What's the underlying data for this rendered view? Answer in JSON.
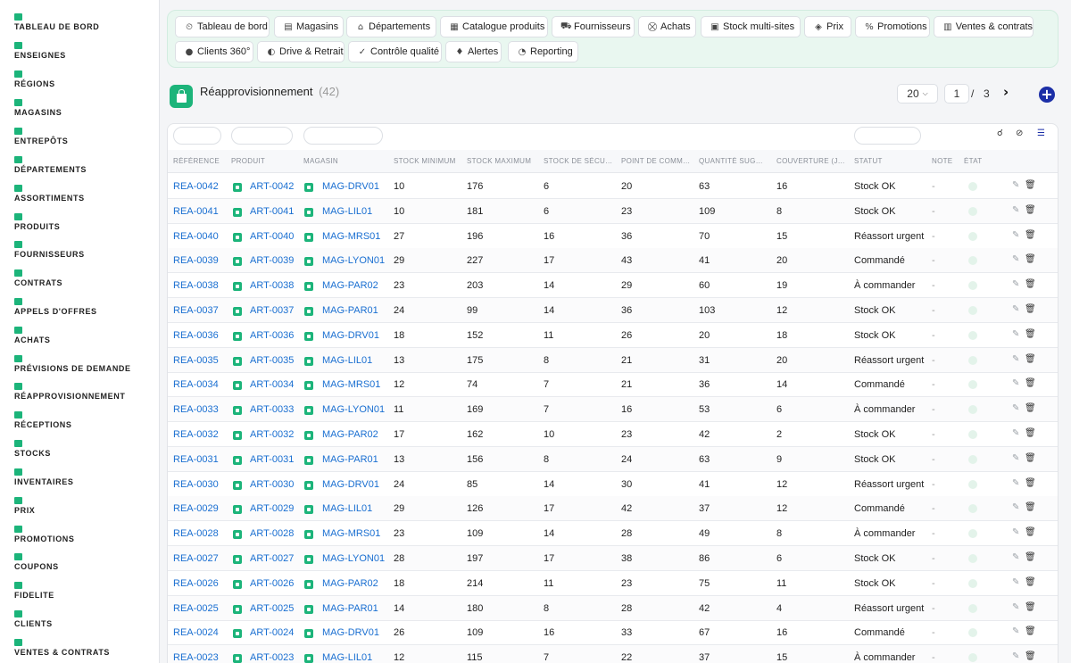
{
  "sidebar": {
    "items": [
      {
        "label": "TABLEAU DE BORD"
      },
      {
        "label": "ENSEIGNES"
      },
      {
        "label": "RÉGIONS"
      },
      {
        "label": "MAGASINS"
      },
      {
        "label": "ENTREPÔTS"
      },
      {
        "label": "DÉPARTEMENTS"
      },
      {
        "label": "ASSORTIMENTS"
      },
      {
        "label": "PRODUITS"
      },
      {
        "label": "FOURNISSEURS"
      },
      {
        "label": "CONTRATS"
      },
      {
        "label": "APPELS D'OFFRES"
      },
      {
        "label": "ACHATS"
      },
      {
        "label": "PRÉVISIONS DE DEMANDE"
      },
      {
        "label": "RÉAPPROVISIONNEMENT"
      },
      {
        "label": "RÉCEPTIONS"
      },
      {
        "label": "STOCKS"
      },
      {
        "label": "INVENTAIRES"
      },
      {
        "label": "PRIX"
      },
      {
        "label": "PROMOTIONS"
      },
      {
        "label": "COUPONS"
      },
      {
        "label": "FIDELITE"
      },
      {
        "label": "CLIENTS"
      },
      {
        "label": "VENTES & CONTRATS"
      }
    ]
  },
  "topnav": {
    "buttons": [
      {
        "label": "Tableau de bord",
        "icon": "⏲"
      },
      {
        "label": "Magasins",
        "icon": "▤"
      },
      {
        "label": "Départements",
        "icon": "⌂"
      },
      {
        "label": "Catalogue produits",
        "icon": "▦"
      },
      {
        "label": "Fournisseurs",
        "icon": "⛟"
      },
      {
        "label": "Achats",
        "icon": "⛒"
      },
      {
        "label": "Stock multi-sites",
        "icon": "▣"
      },
      {
        "label": "Prix",
        "icon": "◈"
      },
      {
        "label": "Promotions",
        "icon": "%"
      },
      {
        "label": "Ventes & contrats",
        "icon": "▥"
      },
      {
        "label": "Clients 360°",
        "icon": "●"
      },
      {
        "label": "Drive & Retrait",
        "icon": "◐"
      },
      {
        "label": "Contrôle qualité",
        "icon": "✓"
      },
      {
        "label": "Alertes",
        "icon": "♦"
      },
      {
        "label": "Reporting",
        "icon": "◔"
      }
    ]
  },
  "header": {
    "title": "Réapprovisionnement",
    "count": "(42)"
  },
  "pagination": {
    "page_size": "20",
    "current_page": "1",
    "separator": "/",
    "total_pages": "3"
  },
  "table": {
    "columns": [
      "RÉFÉRENCE",
      "PRODUIT",
      "MAGASIN",
      "STOCK MINIMUM",
      "STOCK MAXIMUM",
      "STOCK DE SÉCURITÉ",
      "POINT DE COMMANDE",
      "QUANTITÉ SUGGÉRÉE",
      "COUVERTURE (JOURS)",
      "STATUT",
      "NOTE",
      "ÉTAT"
    ],
    "rows": [
      {
        "ref": "REA-0042",
        "product": "ART-0042",
        "store": "MAG-DRV01",
        "min": "10",
        "max": "176",
        "safety": "6",
        "order_point": "20",
        "qty": "63",
        "coverage": "16",
        "status": "Stock OK",
        "note": "-"
      },
      {
        "ref": "REA-0041",
        "product": "ART-0041",
        "store": "MAG-LIL01",
        "min": "10",
        "max": "181",
        "safety": "6",
        "order_point": "23",
        "qty": "109",
        "coverage": "8",
        "status": "Stock OK",
        "note": "-"
      },
      {
        "ref": "REA-0040",
        "product": "ART-0040",
        "store": "MAG-MRS01",
        "min": "27",
        "max": "196",
        "safety": "16",
        "order_point": "36",
        "qty": "70",
        "coverage": "15",
        "status": "Réassort urgent",
        "note": "-"
      },
      {
        "ref": "REA-0039",
        "product": "ART-0039",
        "store": "MAG-LYON01",
        "min": "29",
        "max": "227",
        "safety": "17",
        "order_point": "43",
        "qty": "41",
        "coverage": "20",
        "status": "Commandé",
        "note": "-"
      },
      {
        "ref": "REA-0038",
        "product": "ART-0038",
        "store": "MAG-PAR02",
        "min": "23",
        "max": "203",
        "safety": "14",
        "order_point": "29",
        "qty": "60",
        "coverage": "19",
        "status": "À commander",
        "note": "-"
      },
      {
        "ref": "REA-0037",
        "product": "ART-0037",
        "store": "MAG-PAR01",
        "min": "24",
        "max": "99",
        "safety": "14",
        "order_point": "36",
        "qty": "103",
        "coverage": "12",
        "status": "Stock OK",
        "note": "-"
      },
      {
        "ref": "REA-0036",
        "product": "ART-0036",
        "store": "MAG-DRV01",
        "min": "18",
        "max": "152",
        "safety": "11",
        "order_point": "26",
        "qty": "20",
        "coverage": "18",
        "status": "Stock OK",
        "note": "-"
      },
      {
        "ref": "REA-0035",
        "product": "ART-0035",
        "store": "MAG-LIL01",
        "min": "13",
        "max": "175",
        "safety": "8",
        "order_point": "21",
        "qty": "31",
        "coverage": "20",
        "status": "Réassort urgent",
        "note": "-"
      },
      {
        "ref": "REA-0034",
        "product": "ART-0034",
        "store": "MAG-MRS01",
        "min": "12",
        "max": "74",
        "safety": "7",
        "order_point": "21",
        "qty": "36",
        "coverage": "14",
        "status": "Commandé",
        "note": "-"
      },
      {
        "ref": "REA-0033",
        "product": "ART-0033",
        "store": "MAG-LYON01",
        "min": "11",
        "max": "169",
        "safety": "7",
        "order_point": "16",
        "qty": "53",
        "coverage": "6",
        "status": "À commander",
        "note": "-"
      },
      {
        "ref": "REA-0032",
        "product": "ART-0032",
        "store": "MAG-PAR02",
        "min": "17",
        "max": "162",
        "safety": "10",
        "order_point": "23",
        "qty": "42",
        "coverage": "2",
        "status": "Stock OK",
        "note": "-"
      },
      {
        "ref": "REA-0031",
        "product": "ART-0031",
        "store": "MAG-PAR01",
        "min": "13",
        "max": "156",
        "safety": "8",
        "order_point": "24",
        "qty": "63",
        "coverage": "9",
        "status": "Stock OK",
        "note": "-"
      },
      {
        "ref": "REA-0030",
        "product": "ART-0030",
        "store": "MAG-DRV01",
        "min": "24",
        "max": "85",
        "safety": "14",
        "order_point": "30",
        "qty": "41",
        "coverage": "12",
        "status": "Réassort urgent",
        "note": "-"
      },
      {
        "ref": "REA-0029",
        "product": "ART-0029",
        "store": "MAG-LIL01",
        "min": "29",
        "max": "126",
        "safety": "17",
        "order_point": "42",
        "qty": "37",
        "coverage": "12",
        "status": "Commandé",
        "note": "-"
      },
      {
        "ref": "REA-0028",
        "product": "ART-0028",
        "store": "MAG-MRS01",
        "min": "23",
        "max": "109",
        "safety": "14",
        "order_point": "28",
        "qty": "49",
        "coverage": "8",
        "status": "À commander",
        "note": "-"
      },
      {
        "ref": "REA-0027",
        "product": "ART-0027",
        "store": "MAG-LYON01",
        "min": "28",
        "max": "197",
        "safety": "17",
        "order_point": "38",
        "qty": "86",
        "coverage": "6",
        "status": "Stock OK",
        "note": "-"
      },
      {
        "ref": "REA-0026",
        "product": "ART-0026",
        "store": "MAG-PAR02",
        "min": "18",
        "max": "214",
        "safety": "11",
        "order_point": "23",
        "qty": "75",
        "coverage": "11",
        "status": "Stock OK",
        "note": "-"
      },
      {
        "ref": "REA-0025",
        "product": "ART-0025",
        "store": "MAG-PAR01",
        "min": "14",
        "max": "180",
        "safety": "8",
        "order_point": "28",
        "qty": "42",
        "coverage": "4",
        "status": "Réassort urgent",
        "note": "-"
      },
      {
        "ref": "REA-0024",
        "product": "ART-0024",
        "store": "MAG-DRV01",
        "min": "26",
        "max": "109",
        "safety": "16",
        "order_point": "33",
        "qty": "67",
        "coverage": "16",
        "status": "Commandé",
        "note": "-"
      },
      {
        "ref": "REA-0023",
        "product": "ART-0023",
        "store": "MAG-LIL01",
        "min": "12",
        "max": "115",
        "safety": "7",
        "order_point": "22",
        "qty": "37",
        "coverage": "15",
        "status": "À commander",
        "note": "-"
      }
    ]
  },
  "icons": {
    "search": "search-icon",
    "clear_filter": "clear-filter-icon",
    "columns": "column-list-icon",
    "edit": "pencil-icon",
    "delete": "trash-icon"
  },
  "colors": {
    "accent": "#1cb47a",
    "link": "#1a6fd1",
    "add_button": "#1c2fa7"
  }
}
